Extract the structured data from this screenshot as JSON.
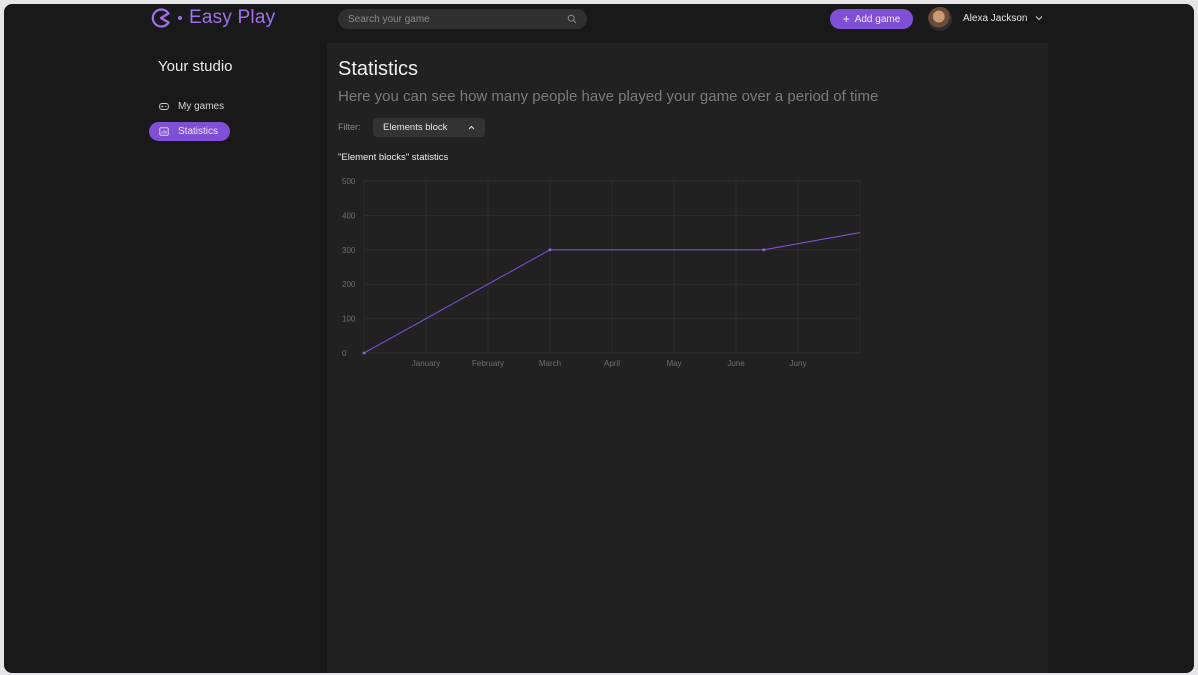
{
  "app": {
    "name": "Easy Play"
  },
  "header": {
    "search_placeholder": "Search your game",
    "add_button": "Add game",
    "user_name": "Alexa Jackson"
  },
  "sidebar": {
    "title": "Your studio",
    "items": [
      {
        "label": "My games",
        "icon": "gamepad-icon",
        "active": false
      },
      {
        "label": "Statistics",
        "icon": "stats-icon",
        "active": true
      }
    ]
  },
  "main": {
    "title": "Statistics",
    "subtitle": "Here you can see how many people have played your game over a period of time",
    "filter_label": "Filter:",
    "filter_value": "Elements block",
    "chart_title": "\"Element blocks\" statistics"
  },
  "colors": {
    "accent": "#7f4fd6",
    "background": "#191919",
    "panel": "#212121",
    "line": "#7a4fd0"
  },
  "chart_data": {
    "type": "line",
    "categories": [
      "January",
      "February",
      "March",
      "April",
      "May",
      "June",
      "Juny"
    ],
    "yticks": [
      0,
      100,
      200,
      300,
      400,
      500
    ],
    "ylim": [
      0,
      500
    ],
    "points": [
      {
        "x": 0,
        "y": 0
      },
      {
        "x": 3,
        "y": 300
      },
      {
        "x": 6.45,
        "y": 300
      },
      {
        "x": 8,
        "y": 350
      }
    ],
    "marker_indices": [
      0,
      1,
      2
    ],
    "grid": true,
    "title": "\"Element blocks\" statistics"
  }
}
